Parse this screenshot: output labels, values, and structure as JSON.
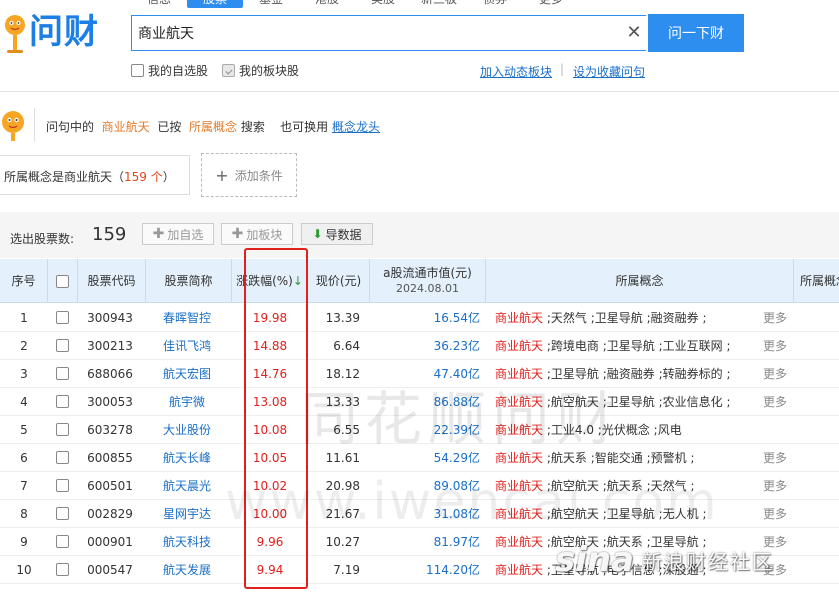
{
  "brand": {
    "logo_text": "问财"
  },
  "nav": {
    "tabs": [
      "信息",
      "股票",
      "基金",
      "港股",
      "美股",
      "新三板",
      "债券",
      "更多"
    ],
    "active": "股票"
  },
  "search": {
    "query": "商业航天",
    "ask_label": "问一下财",
    "clear_icon": "close-icon"
  },
  "options": {
    "watchlist": "我的自选股",
    "sector": "我的板块股"
  },
  "links": {
    "dynamic": "加入动态板块",
    "separator": "|",
    "favorite": "设为收藏问句"
  },
  "hint": {
    "prefix": "问句中的",
    "term": "商业航天",
    "mid": "已按",
    "field": "所属概念",
    "action": "搜索",
    "alt": "也可换用",
    "alt_link": "概念龙头"
  },
  "condition": {
    "text": "所属概念是商业航天",
    "count_text": "159 个",
    "open": "（",
    "close": "）",
    "add_label": "添加条件"
  },
  "results": {
    "label": "选出股票数:",
    "count": "159",
    "add_watch": "加自选",
    "add_sector": "加板块",
    "export": "导数据"
  },
  "table": {
    "columns": {
      "index": "序号",
      "code": "股票代码",
      "name": "股票简称",
      "change": "涨跌幅(%)",
      "change_sort": "↓",
      "price": "现价(元)",
      "mcap": "a股流通市值(元)",
      "mcap_date": "2024.08.01",
      "concept": "所属概念",
      "concept2": "所属概念"
    },
    "more_label": "更多",
    "rows": [
      {
        "index": "1",
        "code": "300943",
        "name": "春晖智控",
        "change": "19.98",
        "price": "13.39",
        "mcap": "16.54亿",
        "concepts": [
          "商业航天",
          "天然气",
          "卫星导航",
          "融资融券"
        ],
        "more": true
      },
      {
        "index": "2",
        "code": "300213",
        "name": "佳讯飞鸿",
        "change": "14.88",
        "price": "6.64",
        "mcap": "36.23亿",
        "concepts": [
          "商业航天",
          "跨境电商",
          "卫星导航",
          "工业互联网"
        ],
        "more": true
      },
      {
        "index": "3",
        "code": "688066",
        "name": "航天宏图",
        "change": "14.76",
        "price": "18.12",
        "mcap": "47.40亿",
        "concepts": [
          "商业航天",
          "卫星导航",
          "融资融券",
          "转融券标的"
        ],
        "more": true
      },
      {
        "index": "4",
        "code": "300053",
        "name": "航宇微",
        "change": "13.08",
        "price": "13.33",
        "mcap": "86.88亿",
        "concepts": [
          "商业航天",
          "航空航天",
          "卫星导航",
          "农业信息化"
        ],
        "more": true
      },
      {
        "index": "5",
        "code": "603278",
        "name": "大业股份",
        "change": "10.08",
        "price": "6.55",
        "mcap": "22.39亿",
        "concepts": [
          "商业航天",
          "工业4.0",
          "光伏概念",
          "风电"
        ],
        "more": false
      },
      {
        "index": "6",
        "code": "600855",
        "name": "航天长峰",
        "change": "10.05",
        "price": "11.61",
        "mcap": "54.29亿",
        "concepts": [
          "商业航天",
          "航天系",
          "智能交通",
          "预警机"
        ],
        "more": true
      },
      {
        "index": "7",
        "code": "600501",
        "name": "航天晨光",
        "change": "10.02",
        "price": "20.98",
        "mcap": "89.08亿",
        "concepts": [
          "商业航天",
          "航空航天",
          "航天系",
          "天然气"
        ],
        "more": true
      },
      {
        "index": "8",
        "code": "002829",
        "name": "星网宇达",
        "change": "10.00",
        "price": "21.67",
        "mcap": "31.08亿",
        "concepts": [
          "商业航天",
          "航空航天",
          "卫星导航",
          "无人机"
        ],
        "more": true
      },
      {
        "index": "9",
        "code": "000901",
        "name": "航天科技",
        "change": "9.96",
        "price": "10.27",
        "mcap": "81.97亿",
        "concepts": [
          "商业航天",
          "航空航天",
          "航天系",
          "卫星导航"
        ],
        "more": true
      },
      {
        "index": "10",
        "code": "000547",
        "name": "航天发展",
        "change": "9.94",
        "price": "7.19",
        "mcap": "114.20亿",
        "concepts": [
          "商业航天",
          "卫星导航",
          "电子信息",
          "深股通"
        ],
        "more": true
      }
    ]
  },
  "watermarks": {
    "cn": "同花顺问财",
    "url": "www.iwencai.com",
    "sina": "sina",
    "forum": "新浪财经社区"
  },
  "colors": {
    "accent": "#2e8ef0",
    "up": "#e0201c",
    "link": "#1a6fc7",
    "highlight": "#e07b2c"
  }
}
